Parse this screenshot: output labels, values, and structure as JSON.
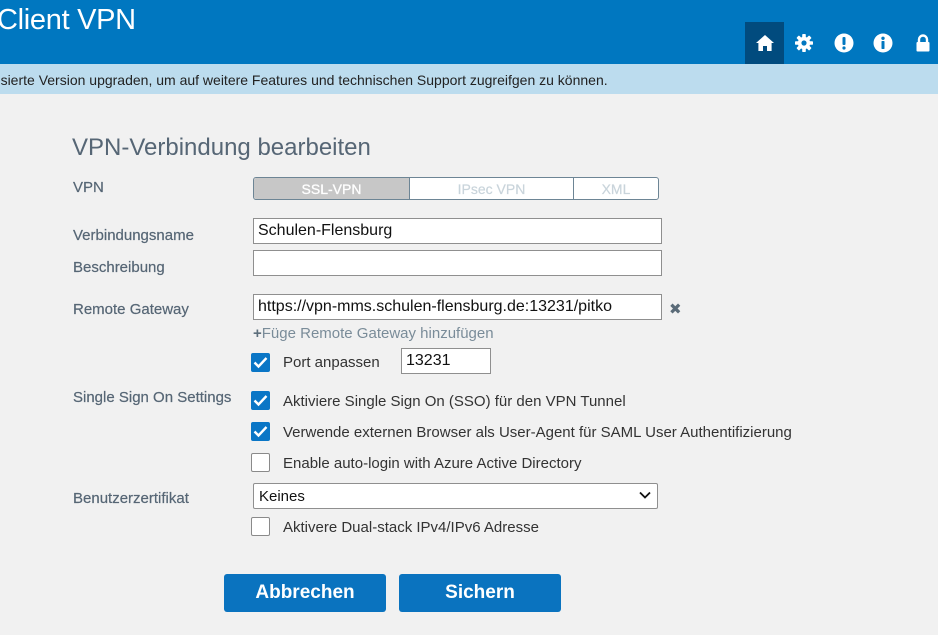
{
  "header": {
    "title": "Client VPN",
    "icons": [
      "home-icon",
      "gear-icon",
      "alert-icon",
      "info-icon",
      "lock-icon"
    ],
    "color": "#0077c0"
  },
  "banner": {
    "text": "zensierte Version upgraden, um auf weitere Features und technischen Support zugreifgen zu können."
  },
  "form": {
    "title": "VPN-Verbindung bearbeiten",
    "vpn": {
      "label": "VPN",
      "options": [
        "SSL-VPN",
        "IPsec VPN",
        "XML"
      ],
      "selected": "SSL-VPN"
    },
    "connection_name": {
      "label": "Verbindungsname",
      "value": "Schulen-Flensburg"
    },
    "description": {
      "label": "Beschreibung",
      "value": ""
    },
    "remote_gateway": {
      "label": "Remote Gateway",
      "value": "https://vpn-mms.schulen-flensburg.de:13231/pitko",
      "remove_icon": "✖",
      "add_plus": "+",
      "add_label": "Füge Remote Gateway hinzufügen"
    },
    "port": {
      "label": "Port anpassen",
      "checked": true,
      "value": "13231"
    },
    "sso": {
      "label": "Single Sign On Settings",
      "options": [
        {
          "label": "Aktiviere Single Sign On (SSO) für den VPN Tunnel",
          "checked": true
        },
        {
          "label": "Verwende externen Browser als User-Agent für SAML User Authentifizierung",
          "checked": true
        },
        {
          "label": "Enable auto-login with Azure Active Directory",
          "checked": false
        }
      ]
    },
    "certificate": {
      "label": "Benutzerzertifikat",
      "value": "Keines"
    },
    "dualstack": {
      "label": "Aktivere Dual-stack IPv4/IPv6 Adresse",
      "checked": false
    }
  },
  "buttons": {
    "cancel": "Abbrechen",
    "save": "Sichern",
    "color": "#0a73bf"
  }
}
